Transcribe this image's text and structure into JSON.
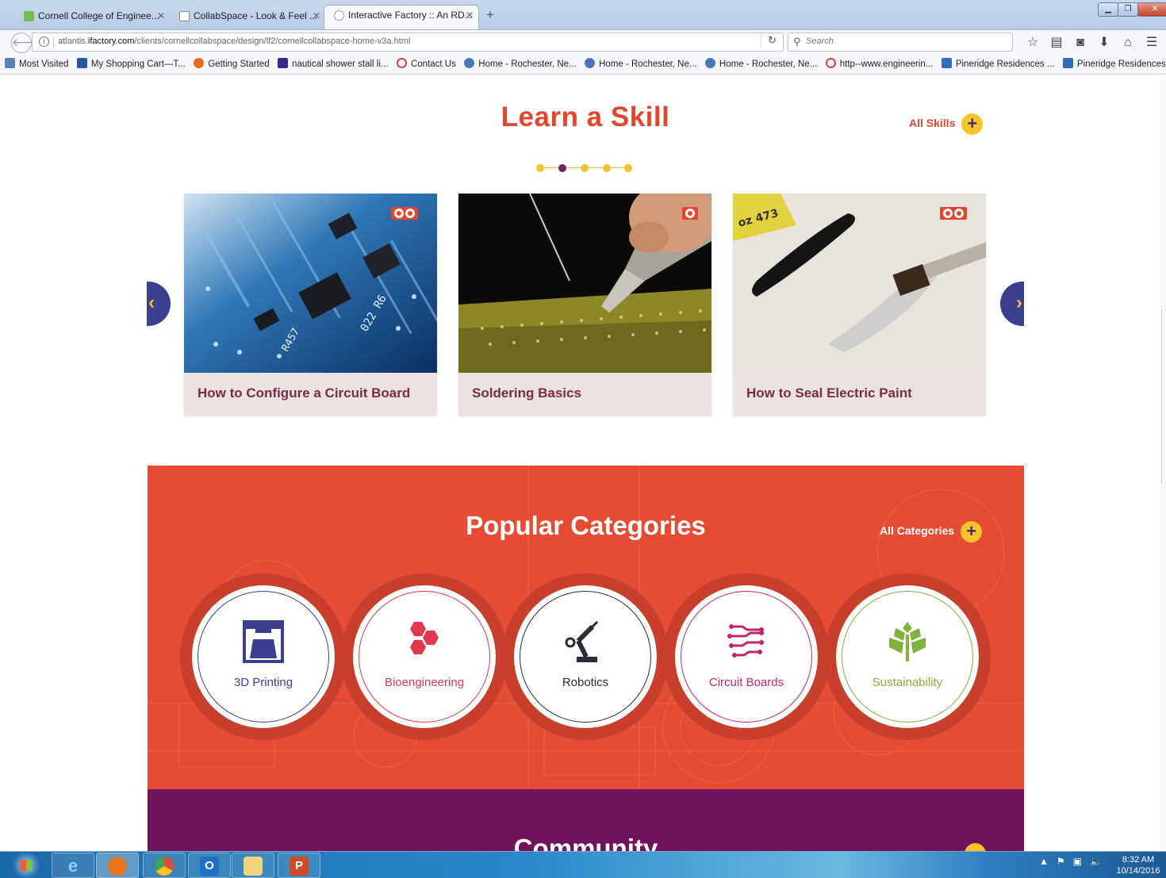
{
  "browser": {
    "tabs": [
      {
        "label": "Cornell College of Enginee...",
        "active": false
      },
      {
        "label": "CollabSpace - Look & Feel ...",
        "active": false
      },
      {
        "label": "Interactive Factory :: An RD...",
        "active": true
      }
    ],
    "url": {
      "host": "atlantis.",
      "domain": "ifactory.com",
      "path": "/clients/cornellcollabspace/design/lf2/cornellcollabspace-home-v3a.html"
    },
    "search_placeholder": "Search",
    "bookmarks": [
      {
        "label": "Most Visited",
        "color": "#5b7fb8"
      },
      {
        "label": "My Shopping Cart—T...",
        "color": "#2a57a3"
      },
      {
        "label": "Getting Started",
        "color": "#e76b1f"
      },
      {
        "label": "nautical shower stall li...",
        "color": "#3b2a8a"
      },
      {
        "label": "Contact Us",
        "color": "#d9433a"
      },
      {
        "label": "Home - Rochester, Ne...",
        "color": "#4a76b8"
      },
      {
        "label": "Home - Rochester, Ne...",
        "color": "#4a76b8"
      },
      {
        "label": "Home - Rochester, Ne...",
        "color": "#4a76b8"
      },
      {
        "label": "http--www.engineerin...",
        "color": "#d9433a"
      },
      {
        "label": "Pineridge Residences ...",
        "color": "#2f6fb5"
      },
      {
        "label": "Pineridge Residences ...",
        "color": "#2f6fb5"
      }
    ]
  },
  "learn": {
    "title": "Learn a Skill",
    "all_link": "All Skills",
    "carousel_active_dot": 1,
    "cards": [
      {
        "title": "How to Configure a Circuit Board",
        "image": "circuit-board-photo",
        "badge": "double"
      },
      {
        "title": "Soldering Basics",
        "image": "soldering-photo",
        "badge": "single"
      },
      {
        "title": "How to Seal Electric Paint",
        "image": "electric-paint-photo",
        "badge": "double"
      }
    ]
  },
  "categories": {
    "title": "Popular Categories",
    "all_link": "All Categories",
    "items": [
      {
        "label": "3D Printing",
        "icon": "3d-printer-icon",
        "color": "#3a3f90"
      },
      {
        "label": "Bioengineering",
        "icon": "hexagon-molecule-icon",
        "color": "#e2384d"
      },
      {
        "label": "Robotics",
        "icon": "robot-arm-icon",
        "color": "#2b2b38"
      },
      {
        "label": "Circuit Boards",
        "icon": "circuit-traces-icon",
        "color": "#c0266b"
      },
      {
        "label": "Sustainability",
        "icon": "leaf-plant-icon",
        "color": "#7fb23a"
      }
    ]
  },
  "community": {
    "title": "Community"
  },
  "colors": {
    "accent": "#e2472d",
    "brand_purple": "#70125c",
    "yellow": "#f4c42a",
    "navy": "#3a3f90"
  },
  "taskbar": {
    "time": "8:32 AM",
    "date": "10/14/2016"
  }
}
